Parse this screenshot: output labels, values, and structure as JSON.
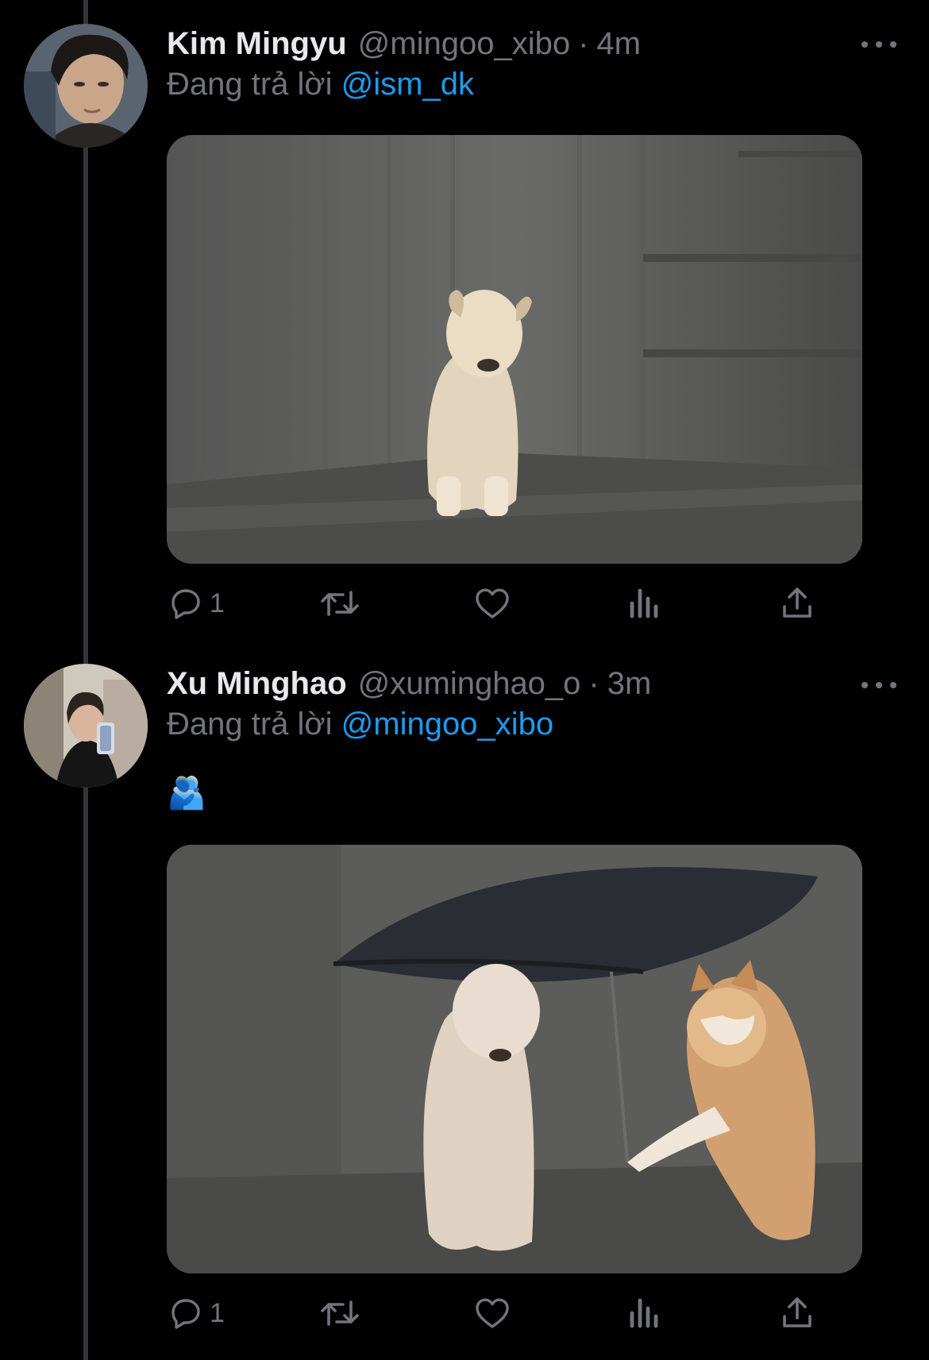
{
  "tweets": [
    {
      "display_name": "Kim Mingyu",
      "handle": "@mingoo_xibo",
      "separator": "·",
      "time": "4m",
      "reply_prefix": "Đang trả lời",
      "reply_to": "@ism_dk",
      "text": "",
      "avatar_icon": "person-avatar",
      "media_icon": "dog-in-rain-image",
      "actions": {
        "reply_count": "1",
        "retweet_count": "",
        "like_count": "",
        "views_count": ""
      }
    },
    {
      "display_name": "Xu Minghao",
      "handle": "@xuminghao_o",
      "separator": "·",
      "time": "3m",
      "reply_prefix": "Đang trả lời",
      "reply_to": "@mingoo_xibo",
      "text": "🫂",
      "avatar_icon": "person-avatar",
      "media_icon": "dog-holding-umbrella-image",
      "actions": {
        "reply_count": "1",
        "retweet_count": "",
        "like_count": "",
        "views_count": ""
      }
    }
  ],
  "colors": {
    "background": "#000000",
    "text": "#e7e9ea",
    "muted": "#71767b",
    "link": "#1d9bf0",
    "thread_line": "#333639"
  }
}
